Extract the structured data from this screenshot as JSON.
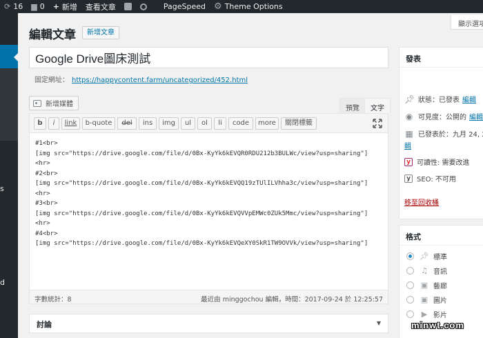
{
  "adminbar": {
    "updates_count": "16",
    "comments_count": "0",
    "new_label": "新增",
    "view_post_label": "查看文章",
    "pagespeed_label": "PageSpeed",
    "theme_options_label": "Theme Options"
  },
  "sidebar": {
    "fragment_s": "s",
    "fragment_d": "d"
  },
  "screen_options_label": "顯示選項",
  "page": {
    "title": "編輯文章",
    "add_new_label": "新增文章"
  },
  "post": {
    "title": "Google Drive圖床測試",
    "permalink_label": "固定網址：",
    "permalink_url": "https://happycontent.farm/uncategorized/452.html"
  },
  "editor": {
    "add_media_label": "新增媒體",
    "tab_visual": "預覽",
    "tab_text": "文字",
    "quicktags": [
      "b",
      "i",
      "link",
      "b-quote",
      "del",
      "ins",
      "img",
      "ul",
      "ol",
      "li",
      "code",
      "more",
      "關閉標籤"
    ],
    "content": "#1<br>\n[img src=\"https://drive.google.com/file/d/0Bx-KyYk6kEVQR0RDU212b3BULWc/view?usp=sharing\"]\n<hr>\n#2<br>\n[img src=\"https://drive.google.com/file/d/0Bx-KyYk6kEVQQ19zTUlILVhha3c/view?usp=sharing\"]\n<hr>\n#3<br>\n[img src=\"https://drive.google.com/file/d/0Bx-KyYk6kEVQVVpEMWc0ZUk5Mmc/view?usp=sharing\"]\n<hr>\n#4<br>\n[img src=\"https://drive.google.com/file/d/0Bx-KyYk6kEVQeXY0SkR1TW9OVVk/view?usp=sharing\"]",
    "word_count": "字數統計：8",
    "last_edited": "最近由 minggochou 編輯，時間：2017-09-24 於 12:25:57"
  },
  "discussion": {
    "title": "討論"
  },
  "publish": {
    "title": "發表",
    "status_label": "狀態：已發表",
    "status_edit": "編輯",
    "visibility_label": "可見度：公開的",
    "visibility_edit": "編輯",
    "published_on": "已發表於：九月 24, 2",
    "published_on_cont": "輯",
    "readability": "可讀性: 需要改進",
    "seo": "SEO: 不可用",
    "trash_label": "移至回收桶"
  },
  "format": {
    "title": "格式",
    "options": [
      "標準",
      "音訊",
      "藝廊",
      "圖片",
      "影片"
    ],
    "selected_index": 0
  },
  "watermark": "minwt.com",
  "colors": {
    "adminbar_bg": "#23282d",
    "accent_blue": "#0073aa",
    "trash_red": "#a00000",
    "yoast_red": "#dc3232"
  }
}
